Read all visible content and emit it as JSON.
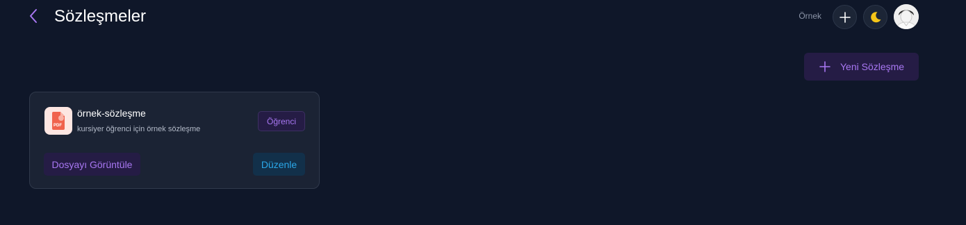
{
  "header": {
    "title": "Sözleşmeler",
    "user_label": "Örnek"
  },
  "toolbar": {
    "new_contract_label": "Yeni Sözleşme"
  },
  "contracts": [
    {
      "title": "örnek-sözleşme",
      "description": "kursiyer öğrenci için örnek sözleşme",
      "role": "Öğrenci",
      "file_type": "PDF",
      "view_label": "Dosyayı Görüntüle",
      "edit_label": "Düzenle"
    }
  ],
  "colors": {
    "background": "#0f1729",
    "card": "#1b2334",
    "accent_purple": "#a877f2",
    "accent_blue": "#2aa7e8",
    "theme_icon": "#f5c518"
  },
  "icons": {
    "back": "chevron-left-icon",
    "add": "plus-icon",
    "theme": "moon-icon",
    "file": "pdf-file-icon"
  }
}
